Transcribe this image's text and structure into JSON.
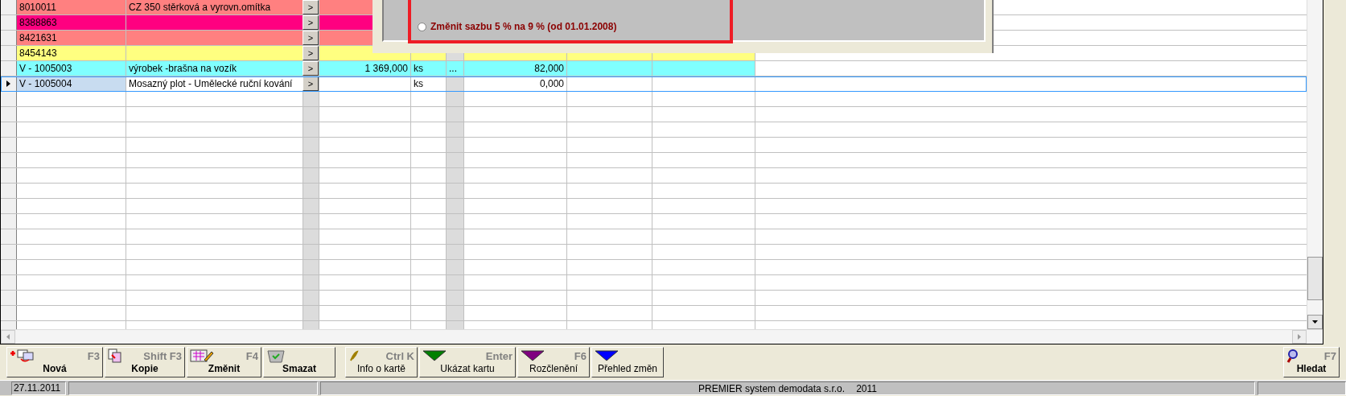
{
  "grid": {
    "rows": [
      {
        "pick": ">",
        "code": "8010011",
        "name": "CZ 350 stěrková a vyrovn.omítka",
        "quantity": "",
        "unit": "",
        "more": "",
        "value": "",
        "color": "#ff8080",
        "selected": false
      },
      {
        "pick": ">",
        "code": "8388863",
        "name": "",
        "quantity": "",
        "unit": "",
        "more": "",
        "value": "",
        "color": "#ff0080",
        "selected": false
      },
      {
        "pick": ">",
        "code": "8421631",
        "name": "",
        "quantity": "",
        "unit": "",
        "more": "",
        "value": "",
        "color": "#ff8080",
        "selected": false
      },
      {
        "pick": ">",
        "code": "8454143",
        "name": "",
        "quantity": "",
        "unit": "",
        "more": "",
        "value": "",
        "color": "#ffff80",
        "selected": false
      },
      {
        "pick": ">",
        "code": "V - 1005003",
        "name": "výrobek -brašna na vozík",
        "quantity": "1 369,000",
        "unit": "ks",
        "more": "...",
        "value": "82,000",
        "color": "#80ffff",
        "selected": false
      },
      {
        "pick": ">",
        "code": "V - 1005004",
        "name": "Mosazný plot - Umělecké ruční kování",
        "quantity": "",
        "unit": "ks",
        "more": "",
        "value": "0,000",
        "color": "#ffffff",
        "selected": true
      }
    ]
  },
  "dialog": {
    "options": [
      {
        "label": "Změnit sazbu 5 % na 9 % (od 01.01.2008)",
        "selected": false
      }
    ]
  },
  "toolbar": [
    {
      "kind": "new",
      "label": "Nová",
      "shortcut": "F3",
      "bold": true
    },
    {
      "kind": "copy",
      "label": "Kopie",
      "shortcut": "Shift F3",
      "bold": true
    },
    {
      "kind": "edit",
      "label": "Změnit",
      "shortcut": "F4",
      "bold": true
    },
    {
      "kind": "delete",
      "label": "Smazat",
      "bold": true
    },
    {
      "kind": "info",
      "label": "Info o kartě",
      "shortcut": "Ctrl K",
      "bold": false
    },
    {
      "kind": "triangle",
      "label": "Ukázat kartu",
      "shortcut": "Enter",
      "bold": false,
      "color": "#008000"
    },
    {
      "kind": "triangle",
      "label": "Rozčlenění",
      "shortcut": "F6",
      "bold": false,
      "color": "#800080"
    },
    {
      "kind": "triangle",
      "label": "Přehled změn",
      "bold": false,
      "color": "#0000ff"
    }
  ],
  "search_button": {
    "label": "Hledat",
    "shortcut": "F7"
  },
  "status_bar": {
    "date": "27.11.2011",
    "company": "PREMIER system demodata s.r.o.",
    "year": "2011"
  }
}
